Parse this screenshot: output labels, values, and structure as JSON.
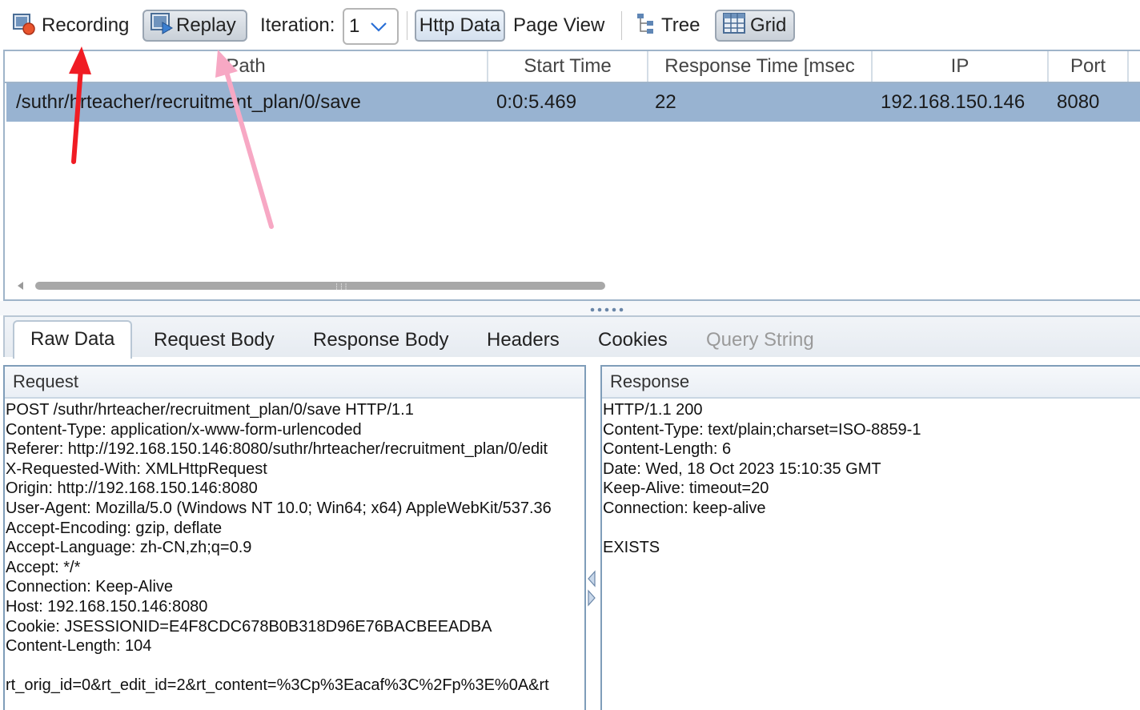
{
  "toolbar": {
    "recording_label": "Recording",
    "replay_label": "Replay",
    "iteration_label": "Iteration:",
    "iteration_value": "1",
    "http_data_label": "Http Data",
    "page_view_label": "Page View",
    "tree_label": "Tree",
    "grid_label": "Grid"
  },
  "grid": {
    "columns": [
      "Path",
      "Start Time",
      "Response Time [msec",
      "IP",
      "Port"
    ],
    "rows": [
      {
        "path": "/suthr/hrteacher/recruitment_plan/0/save",
        "start_time": "0:0:5.469",
        "response_time": "22",
        "ip": "192.168.150.146",
        "port": "8080"
      }
    ]
  },
  "tabs": [
    "Raw Data",
    "Request Body",
    "Response Body",
    "Headers",
    "Cookies",
    "Query String"
  ],
  "request": {
    "title": "Request",
    "lines": [
      "POST /suthr/hrteacher/recruitment_plan/0/save HTTP/1.1",
      "Content-Type: application/x-www-form-urlencoded",
      "Referer: http://192.168.150.146:8080/suthr/hrteacher/recruitment_plan/0/edit",
      "X-Requested-With: XMLHttpRequest",
      "Origin: http://192.168.150.146:8080",
      "User-Agent: Mozilla/5.0 (Windows NT 10.0; Win64; x64) AppleWebKit/537.36",
      "Accept-Encoding: gzip, deflate",
      "Accept-Language: zh-CN,zh;q=0.9",
      "Accept: */*",
      "Connection: Keep-Alive",
      "Host: 192.168.150.146:8080",
      "Cookie: JSESSIONID=E4F8CDC678B0B318D96E76BACBEEADBA",
      "Content-Length: 104",
      "",
      "rt_orig_id=0&rt_edit_id=2&rt_content=%3Cp%3Eacaf%3C%2Fp%3E%0A&rt"
    ]
  },
  "response": {
    "title": "Response",
    "lines": [
      "HTTP/1.1 200",
      "Content-Type: text/plain;charset=ISO-8859-1",
      "Content-Length: 6",
      "Date: Wed, 18 Oct 2023 15:10:35 GMT",
      "Keep-Alive: timeout=20",
      "Connection: keep-alive",
      "",
      "EXISTS"
    ]
  },
  "colors": {
    "selected_row": "#98b3d1",
    "annotation_red": "#f01c24",
    "annotation_pink": "#f7a8c4"
  }
}
